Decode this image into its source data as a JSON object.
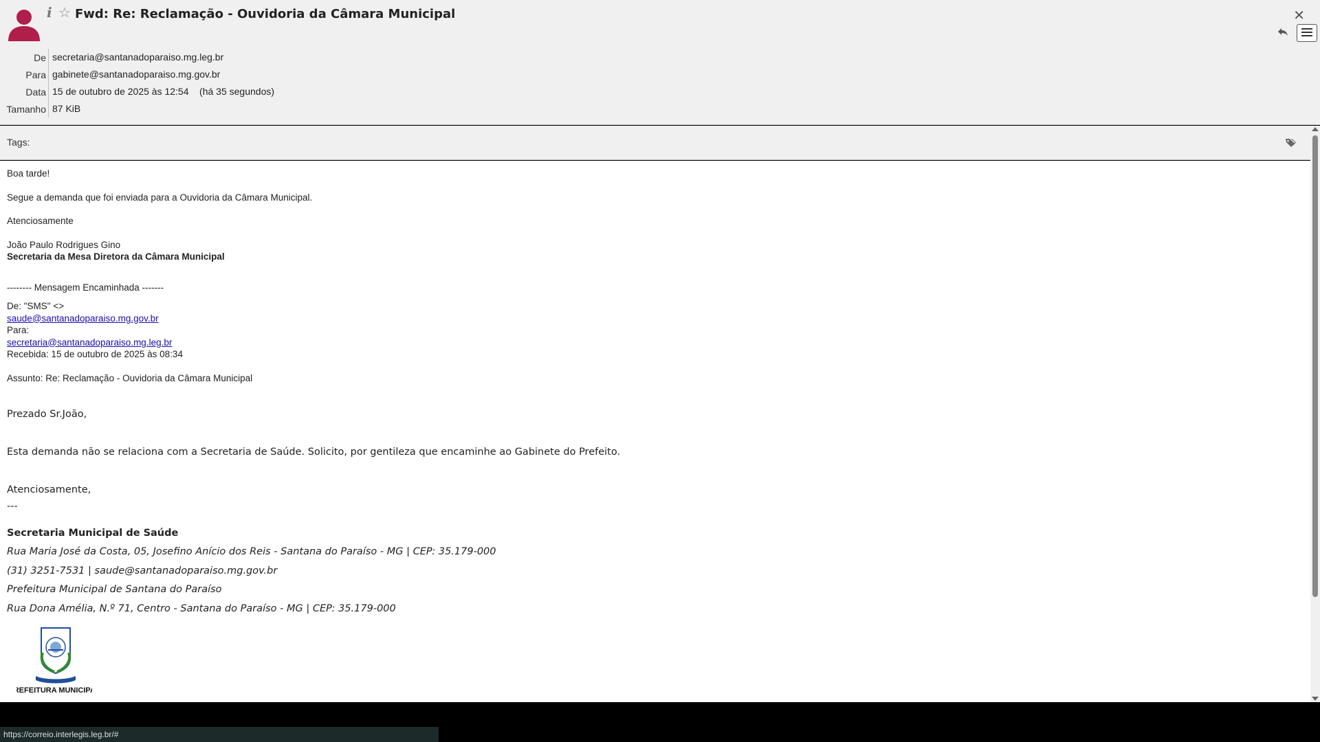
{
  "header": {
    "subject": "Fwd: Re: Reclamação - Ouvidoria da Câmara Municipal",
    "fields": [
      {
        "label": "De",
        "value": "secretaria@santanadoparaiso.mg.leg.br"
      },
      {
        "label": "Para",
        "value": "gabinete@santanadoparaiso.mg.gov.br"
      },
      {
        "label": "Data",
        "value": "15 de outubro de 2025 às 12:54    (há 35 segundos)"
      },
      {
        "label": "Tamanho",
        "value": "87 KiB"
      }
    ],
    "icons": {
      "avatar": "user-avatar-icon",
      "info": "info-icon",
      "star": "star-icon",
      "close": "close-icon",
      "reply": "reply-icon",
      "menu": "menu-icon"
    },
    "avatar_color": "#b01e4a"
  },
  "tags": {
    "label": "Tags:",
    "icon": "tag-icon"
  },
  "body": {
    "greeting": "Boa tarde!",
    "intro": "Segue a demanda que foi enviada para a Ouvidoria da Câmara Municipal.",
    "closing": "Atenciosamente",
    "sender_name": "João Paulo Rodrigues Gino",
    "sender_title": "Secretaria da Mesa Diretora da Câmara Municipal",
    "forward_header": "-------- Mensagem Encaminhada -------",
    "fwd_from": "De: \"SMS\" <>",
    "fwd_from_email": "saude@santanadoparaiso.mg.gov.br",
    "fwd_to": "Para:",
    "fwd_to_email": "secretaria@santanadoparaiso.mg.leg.br",
    "fwd_received": "Recebida: 15 de outubro de 2025 às 08:34",
    "fwd_subject": "Assunto: Re: Reclamação - Ouvidoria da Câmara Municipal",
    "reply_greeting": "Prezado Sr.João,",
    "reply_text": "Esta demanda não se relaciona com a Secretaria de Saúde. Solicito, por gentileza que encaminhe ao Gabinete do Prefeito.",
    "reply_closing": "Atenciosamente,",
    "reply_dashes": "---",
    "sig_title": "Secretaria Municipal de Saúde",
    "sig_lines": [
      "Rua Maria José da Costa, 05, Josefino Anício dos Reis - Santana do Paraíso - MG | CEP: 35.179-000",
      "(31) 3251-7531 | saude@santanadoparaiso.mg.gov.br",
      "Prefeitura Municipal de Santana do Paraíso",
      "Rua Dona Amélia, N.º 71, Centro - Santana do Paraíso - MG | CEP: 35.179-000"
    ],
    "crest_text": "PREFEITURA MUNICIPAL"
  },
  "status_url": "https://correio.interlegis.leg.br/#"
}
